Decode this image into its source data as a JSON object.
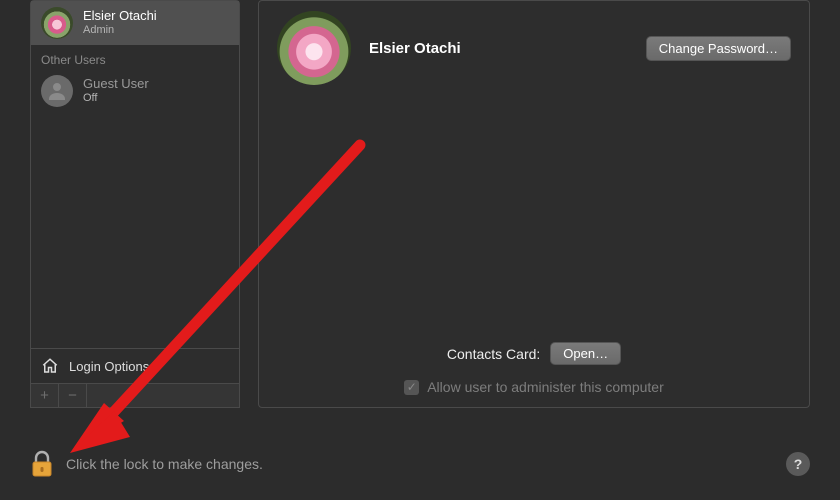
{
  "sidebar": {
    "current_user": {
      "name": "Elsier Otachi",
      "role": "Admin"
    },
    "section_label": "Other Users",
    "guest": {
      "name": "Guest User",
      "status": "Off"
    },
    "login_options_label": "Login Options",
    "add_symbol": "+",
    "remove_symbol": "−"
  },
  "main": {
    "display_name": "Elsier Otachi",
    "change_password_label": "Change Password…",
    "contacts_label": "Contacts Card:",
    "open_label": "Open…",
    "admin_checkbox_label": "Allow user to administer this computer"
  },
  "footer": {
    "lock_hint": "Click the lock to make changes.",
    "help_symbol": "?"
  }
}
